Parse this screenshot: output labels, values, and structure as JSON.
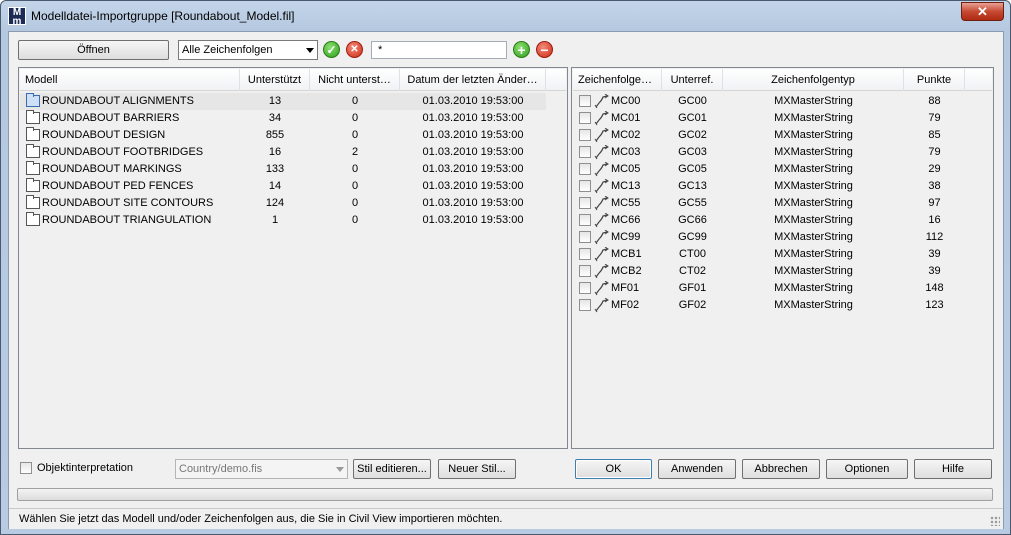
{
  "window": {
    "title": "Modelldatei-Importgruppe [Roundabout_Model.fil]",
    "close_glyph": "✕"
  },
  "toolbar": {
    "open_label": "Öffnen",
    "filter_select": "Alle Zeichenfolgen",
    "filter_text": "*"
  },
  "models": {
    "columns": [
      "Modell",
      "Unterstützt",
      "Nicht unterst…",
      "Datum der letzten Änder…"
    ],
    "rows": [
      {
        "name": "ROUNDABOUT ALIGNMENTS",
        "supported": "13",
        "unsupported": "0",
        "date": "01.03.2010 19:53:00"
      },
      {
        "name": "ROUNDABOUT BARRIERS",
        "supported": "34",
        "unsupported": "0",
        "date": "01.03.2010 19:53:00"
      },
      {
        "name": "ROUNDABOUT DESIGN",
        "supported": "855",
        "unsupported": "0",
        "date": "01.03.2010 19:53:00"
      },
      {
        "name": "ROUNDABOUT FOOTBRIDGES",
        "supported": "16",
        "unsupported": "2",
        "date": "01.03.2010 19:53:00"
      },
      {
        "name": "ROUNDABOUT MARKINGS",
        "supported": "133",
        "unsupported": "0",
        "date": "01.03.2010 19:53:00"
      },
      {
        "name": "ROUNDABOUT PED FENCES",
        "supported": "14",
        "unsupported": "0",
        "date": "01.03.2010 19:53:00"
      },
      {
        "name": "ROUNDABOUT SITE CONTOURS",
        "supported": "124",
        "unsupported": "0",
        "date": "01.03.2010 19:53:00"
      },
      {
        "name": "ROUNDABOUT TRIANGULATION",
        "supported": "1",
        "unsupported": "0",
        "date": "01.03.2010 19:53:00"
      }
    ]
  },
  "strings": {
    "columns": [
      "Zeichenfolge…",
      "Unterref.",
      "Zeichenfolgentyp",
      "Punkte"
    ],
    "rows": [
      {
        "name": "MC00",
        "subref": "GC00",
        "type": "MXMasterString",
        "points": "88"
      },
      {
        "name": "MC01",
        "subref": "GC01",
        "type": "MXMasterString",
        "points": "79"
      },
      {
        "name": "MC02",
        "subref": "GC02",
        "type": "MXMasterString",
        "points": "85"
      },
      {
        "name": "MC03",
        "subref": "GC03",
        "type": "MXMasterString",
        "points": "79"
      },
      {
        "name": "MC05",
        "subref": "GC05",
        "type": "MXMasterString",
        "points": "29"
      },
      {
        "name": "MC13",
        "subref": "GC13",
        "type": "MXMasterString",
        "points": "38"
      },
      {
        "name": "MC55",
        "subref": "GC55",
        "type": "MXMasterString",
        "points": "97"
      },
      {
        "name": "MC66",
        "subref": "GC66",
        "type": "MXMasterString",
        "points": "16"
      },
      {
        "name": "MC99",
        "subref": "GC99",
        "type": "MXMasterString",
        "points": "112"
      },
      {
        "name": "MCB1",
        "subref": "CT00",
        "type": "MXMasterString",
        "points": "39"
      },
      {
        "name": "MCB2",
        "subref": "CT02",
        "type": "MXMasterString",
        "points": "39"
      },
      {
        "name": "MF01",
        "subref": "GF01",
        "type": "MXMasterString",
        "points": "148"
      },
      {
        "name": "MF02",
        "subref": "GF02",
        "type": "MXMasterString",
        "points": "123"
      }
    ]
  },
  "bottom": {
    "object_interpretation_label": "Objektinterpretation",
    "style_file": "Country/demo.fis",
    "edit_style_label": "Stil editieren...",
    "new_style_label": "Neuer Stil...",
    "ok_label": "OK",
    "apply_label": "Anwenden",
    "cancel_label": "Abbrechen",
    "options_label": "Optionen",
    "help_label": "Hilfe"
  },
  "status": {
    "text": "Wählen Sie jetzt das Modell und/oder Zeichenfolgen aus, die Sie in Civil View importieren möchten."
  },
  "colors": {
    "accent_green": "#2f9d1c",
    "accent_red": "#cf2a15",
    "selection": "#e6e6e6"
  }
}
